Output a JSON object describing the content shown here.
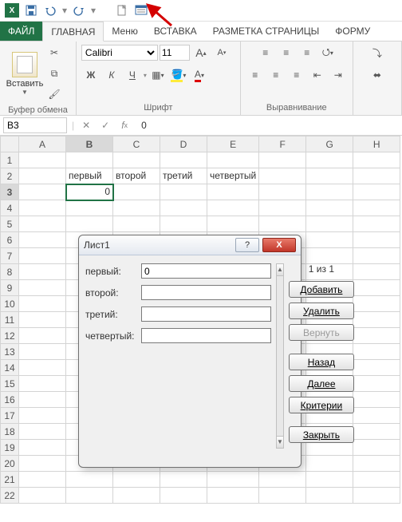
{
  "qat": {
    "save_icon": "save-icon",
    "undo_icon": "undo-icon",
    "redo_icon": "redo-icon",
    "new_icon": "new-file-icon",
    "form_icon": "form-icon"
  },
  "tabs": {
    "file": "ФАЙЛ",
    "home": "ГЛАВНАЯ",
    "menu": "Меню",
    "insert": "ВСТАВКА",
    "pagelayout": "РАЗМЕТКА СТРАНИЦЫ",
    "formulas": "ФОРМУ"
  },
  "ribbon": {
    "clipboard": {
      "paste": "Вставить",
      "label": "Буфер обмена"
    },
    "font": {
      "name": "Calibri",
      "size": "11",
      "bold": "Ж",
      "italic": "К",
      "underline": "Ч",
      "label": "Шрифт",
      "grow": "A",
      "shrink": "A"
    },
    "alignment": {
      "label": "Выравнивание"
    }
  },
  "namebox": {
    "ref": "B3"
  },
  "formula_bar": {
    "value": "0"
  },
  "columns": [
    "A",
    "B",
    "C",
    "D",
    "E",
    "F",
    "G",
    "H"
  ],
  "rows": [
    "1",
    "2",
    "3",
    "4",
    "5",
    "6",
    "7",
    "8",
    "9",
    "10",
    "11",
    "12",
    "13",
    "14",
    "15",
    "16",
    "17",
    "18",
    "19",
    "20",
    "21",
    "22"
  ],
  "cells": {
    "B2": "первый",
    "C2": "второй",
    "D2": "третий",
    "E2": "четвертый",
    "B3": "0"
  },
  "active_cell": "B3",
  "dialog": {
    "title": "Лист1",
    "counter": "1 из 1",
    "fields": [
      {
        "label": "первый:",
        "value": "0"
      },
      {
        "label": "второй:",
        "value": ""
      },
      {
        "label": "третий:",
        "value": ""
      },
      {
        "label": "четвертый:",
        "value": ""
      }
    ],
    "buttons": {
      "add": "Добавить",
      "delete": "Удалить",
      "restore": "Вернуть",
      "back": "Назад",
      "next": "Далее",
      "criteria": "Критерии",
      "close": "Закрыть"
    },
    "help": "?",
    "x": "X"
  }
}
